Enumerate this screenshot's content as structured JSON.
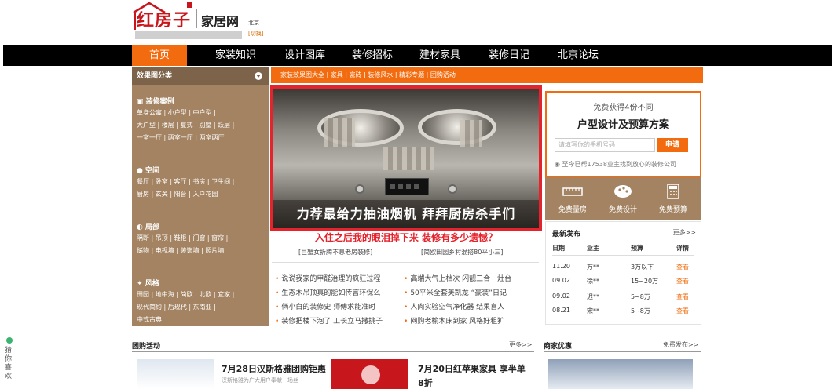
{
  "header": {
    "logo_main": "红房子",
    "logo_sub": "家居网",
    "city": "北京",
    "switch_city": "[切换]"
  },
  "nav": {
    "items": [
      {
        "label": "首页"
      },
      {
        "label": "家装知识"
      },
      {
        "label": "设计图库"
      },
      {
        "label": "装修招标"
      },
      {
        "label": "建材家具"
      },
      {
        "label": "装修日记"
      },
      {
        "label": "北京论坛"
      }
    ]
  },
  "sidebar": {
    "header": "效果图分类",
    "sections": [
      {
        "title": "装修案例",
        "lines": [
          "单身公寓 | 小户型 | 中户型 |",
          "大户型 | 楼层 | 复式 | 别墅 | 跃层 |",
          "一室一厅 | 两室一厅 | 两室两厅"
        ]
      },
      {
        "title": "空间",
        "lines": [
          "餐厅 | 卧室 | 客厅 | 书房 | 卫生间 |",
          "厨房 | 玄关 | 阳台 | 入户花园"
        ]
      },
      {
        "title": "局部",
        "lines": [
          "隔断 | 吊顶 | 鞋柜 | 门窗 | 窗帘 |",
          "储物 | 电视墙 | 装饰墙 | 照片墙"
        ]
      },
      {
        "title": "风格",
        "lines": [
          "田园 | 地中海 | 简欧 | 北欧 | 宜家 |",
          "现代简约 | 后现代 | 东南亚 |",
          "中式古典"
        ]
      }
    ]
  },
  "subnav": {
    "text": "家装效果图大全  |  家具  |  瓷砖  |  装修风水  |  精彩专题  |  团购活动"
  },
  "banner": {
    "caption": "力荐最给力抽油烟机 拜拜厨房杀手们"
  },
  "headline": {
    "title": "入住之后我的眼泪掉下来 装修有多少遗憾？",
    "sub_left": "[巨蟹女折腾不息老房装修]",
    "sub_right": "[简欧田园乡村混搭80平小三]"
  },
  "news": {
    "left": [
      "说说我家的甲醛治理的疯狂过程",
      "生态木吊顶真的能如传言环保么",
      "俩小白的装修史 师傅求能准时",
      "装修把楼下泡了 工长立马撒挑子"
    ],
    "right": [
      "高端大气上档次 闪靓三合一灶台",
      "50平米全套美凯龙 “豪装”日记",
      "人肉实验空气净化器 结果喜人",
      "网购老榆木床到家 风格好粗犷"
    ]
  },
  "right_panel": {
    "line1": "免费获得4份不同",
    "line2": "户型设计及预算方案",
    "input_placeholder": "请填写你的手机号码",
    "apply": "申请",
    "note": "至今已帮17538业主找到放心的装修公司"
  },
  "services": [
    {
      "label": "免费量房",
      "icon": "ruler-icon"
    },
    {
      "label": "免费设计",
      "icon": "palette-icon"
    },
    {
      "label": "免费预算",
      "icon": "calculator-icon"
    }
  ],
  "latest": {
    "title": "最新发布",
    "more": "更多>>",
    "headers": [
      "日期",
      "业主",
      "预算",
      "详情"
    ],
    "rows": [
      [
        "11.20",
        "万**",
        "3万以下",
        "查看"
      ],
      [
        "09.02",
        "徐**",
        "15~20万",
        "查看"
      ],
      [
        "09.02",
        "迟**",
        "5~8万",
        "查看"
      ],
      [
        "08.21",
        "宋**",
        "5~8万",
        "查看"
      ]
    ]
  },
  "bottom": {
    "group_title": "团购活动",
    "group_more": "更多>>",
    "merchant_title": "商家优惠",
    "merchant_more": "免费发布>>",
    "promo1_title": "7月28日汉斯格雅团购钜惠",
    "promo1_desc": "汉斯格雅为广大用户奉献一场丝",
    "promo2_title": "7月20日红苹果家具 享半单",
    "promo2_title2": "8折"
  },
  "side_float": {
    "text": "猜你喜欢"
  },
  "colors": {
    "accent": "#f26c0f",
    "brand_red": "#c8161d",
    "sidebar_brown": "#a38362",
    "nav_black": "#000000"
  }
}
